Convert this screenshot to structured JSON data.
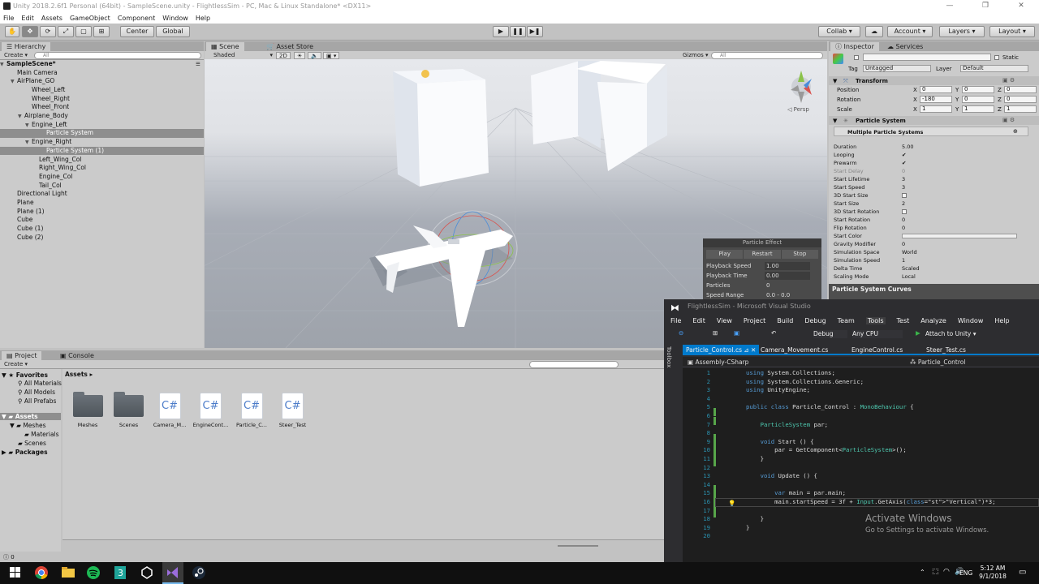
{
  "window": {
    "title": "Unity 2018.2.6f1 Personal (64bit) - SampleScene.unity - FlightlessSim - PC, Mac & Linux Standalone* <DX11>",
    "min": "—",
    "max": "❐",
    "close": "✕"
  },
  "menu": [
    "File",
    "Edit",
    "Assets",
    "GameObject",
    "Component",
    "Window",
    "Help"
  ],
  "toolbar": {
    "center": "Center",
    "global": "Global",
    "collab": "Collab ▾",
    "account": "Account",
    "layers": "Layers",
    "layout": "Layout"
  },
  "hierarchy": {
    "tab": "Hierarchy",
    "create": "Create ▾",
    "search": "All",
    "scene": "SampleScene*",
    "items": [
      {
        "label": "Main Camera",
        "indent": 1,
        "arrow": ""
      },
      {
        "label": "AirPlane_GO",
        "indent": 1,
        "arrow": "▼"
      },
      {
        "label": "Wheel_Left",
        "indent": 3,
        "arrow": ""
      },
      {
        "label": "Wheel_Right",
        "indent": 3,
        "arrow": ""
      },
      {
        "label": "Wheel_Front",
        "indent": 3,
        "arrow": ""
      },
      {
        "label": "Airplane_Body",
        "indent": 2,
        "arrow": "▼"
      },
      {
        "label": "Engine_Left",
        "indent": 3,
        "arrow": "▼"
      },
      {
        "label": "Particle System",
        "indent": 5,
        "arrow": "",
        "selected": true
      },
      {
        "label": "Engine_Right",
        "indent": 3,
        "arrow": "▼"
      },
      {
        "label": "Particle System (1)",
        "indent": 5,
        "arrow": "",
        "selected": true
      },
      {
        "label": "Left_Wing_Col",
        "indent": 4,
        "arrow": ""
      },
      {
        "label": "Right_Wing_Col",
        "indent": 4,
        "arrow": ""
      },
      {
        "label": "Engine_Col",
        "indent": 4,
        "arrow": ""
      },
      {
        "label": "Tail_Col",
        "indent": 4,
        "arrow": ""
      },
      {
        "label": "Directional Light",
        "indent": 1,
        "arrow": ""
      },
      {
        "label": "Plane",
        "indent": 1,
        "arrow": ""
      },
      {
        "label": "Plane (1)",
        "indent": 1,
        "arrow": ""
      },
      {
        "label": "Cube",
        "indent": 1,
        "arrow": ""
      },
      {
        "label": "Cube (1)",
        "indent": 1,
        "arrow": ""
      },
      {
        "label": "Cube (2)",
        "indent": 1,
        "arrow": ""
      }
    ]
  },
  "scene": {
    "tab": "Scene",
    "tab2": "Asset Store",
    "shaded": "Shaded",
    "mode2d": "2D",
    "gizmos": "Gizmos ▾",
    "search": "All",
    "persp": "◁ Persp"
  },
  "particle_effect": {
    "title": "Particle Effect",
    "play": "Play",
    "restart": "Restart",
    "stop": "Stop",
    "speed_label": "Playback Speed",
    "speed": "1.00",
    "time_label": "Playback Time",
    "time": "0.00",
    "particles_label": "Particles",
    "particles": "0",
    "range_label": "Speed Range",
    "range": "0.0 - 0.0"
  },
  "inspector": {
    "tab": "Inspector",
    "tab2": "Services",
    "static": "Static",
    "tag_label": "Tag",
    "tag": "Untagged",
    "layer_label": "Layer",
    "layer": "Default",
    "transform": "Transform",
    "position": "Position",
    "rotation": "Rotation",
    "scale": "Scale",
    "pos": {
      "x": "0",
      "y": "0",
      "z": "0"
    },
    "rot": {
      "x": "-180",
      "y": "0",
      "z": "0"
    },
    "scl": {
      "x": "1",
      "y": "1",
      "z": "1"
    },
    "ps_title": "Particle System",
    "ps_sub": "Multiple Particle Systems",
    "props": [
      {
        "label": "Duration",
        "value": "5.00"
      },
      {
        "label": "Looping",
        "value": "✔"
      },
      {
        "label": "Prewarm",
        "value": "✔"
      },
      {
        "label": "Start Delay",
        "value": "0",
        "dim": true
      },
      {
        "label": "Start Lifetime",
        "value": "3"
      },
      {
        "label": "Start Speed",
        "value": "3"
      },
      {
        "label": "3D Start Size",
        "value": ""
      },
      {
        "label": "Start Size",
        "value": "2"
      },
      {
        "label": "3D Start Rotation",
        "value": ""
      },
      {
        "label": "Start Rotation",
        "value": "0"
      },
      {
        "label": "Flip Rotation",
        "value": "0"
      },
      {
        "label": "Start Color",
        "value": ""
      },
      {
        "label": "Gravity Modifier",
        "value": "0"
      },
      {
        "label": "Simulation Space",
        "value": "World"
      },
      {
        "label": "Simulation Speed",
        "value": "1"
      },
      {
        "label": "Delta Time",
        "value": "Scaled"
      },
      {
        "label": "Scaling Mode",
        "value": "Local"
      }
    ],
    "curves": "Particle System Curves"
  },
  "project": {
    "tab": "Project",
    "tab2": "Console",
    "create": "Create ▾",
    "breadcrumb": "Assets ▸",
    "favorites": "Favorites",
    "fav_items": [
      "All Materials",
      "All Models",
      "All Prefabs"
    ],
    "assets": "Assets",
    "tree": [
      "Meshes",
      "Materials",
      "Scenes"
    ],
    "packages": "Packages",
    "assets_list": [
      {
        "label": "Meshes",
        "kind": "folder"
      },
      {
        "label": "Scenes",
        "kind": "folder"
      },
      {
        "label": "Camera_M...",
        "kind": "cs"
      },
      {
        "label": "EngineCont...",
        "kind": "cs"
      },
      {
        "label": "Particle_C...",
        "kind": "cs"
      },
      {
        "label": "Steer_Test",
        "kind": "cs"
      }
    ],
    "cs_glyph": "C#"
  },
  "status": {
    "text": "0"
  },
  "vs": {
    "title": "FlightlessSim - Microsoft Visual Studio",
    "menu": [
      "File",
      "Edit",
      "View",
      "Project",
      "Build",
      "Debug",
      "Team",
      "Tools",
      "Test",
      "Analyze",
      "Window",
      "Help"
    ],
    "debug": "Debug",
    "cpu": "Any CPU",
    "attach": "Attach to Unity ▾",
    "toolbox": "Toolbox",
    "tabs": [
      "Particle_Control.cs",
      "Camera_Movement.cs",
      "EngineControl.cs",
      "Steer_Test.cs"
    ],
    "project_dd": "Assembly-CSharp",
    "class_dd": "Particle_Control",
    "lines": [
      "using System.Collections;",
      "using System.Collections.Generic;",
      "using UnityEngine;",
      "",
      "public class Particle_Control : MonoBehaviour {",
      "",
      "    ParticleSystem par;",
      "",
      "    void Start () {",
      "        par = GetComponent<ParticleSystem>();",
      "    }",
      "",
      "    void Update () {",
      "",
      "        var main = par.main;",
      "        main.startSpeed = 3f + Input.GetAxis(\"Vertical\")*3;",
      "",
      "    }",
      "}",
      ""
    ],
    "watermark1": "Activate Windows",
    "watermark2": "Go to Settings to activate Windows."
  },
  "taskbar": {
    "time": "5:12 AM",
    "date": "9/1/2018",
    "lang": "ENG"
  }
}
